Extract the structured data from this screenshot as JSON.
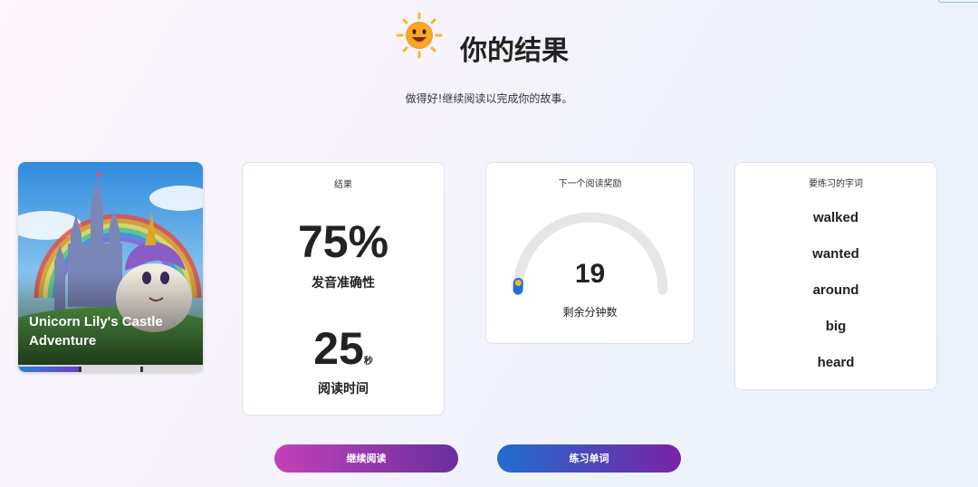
{
  "header": {
    "title": "你的结果",
    "icon": "sun-mascot-icon"
  },
  "subtitle": "做得好!继续阅读以完成你的故事。",
  "book": {
    "title": "Unicorn Lily's Castle Adventure",
    "progress": 0.33,
    "colors": {
      "progress_start": "#2f7fdc",
      "progress_end": "#6d3fbf"
    }
  },
  "results": {
    "label": "结果",
    "accuracy_value": "75%",
    "accuracy_label": "发音准确性",
    "time_value": "25",
    "time_unit": "秒",
    "time_label": "阅读时间"
  },
  "reward": {
    "label": "下一个阅读奖励",
    "minutes": "19",
    "minutes_label": "剩余分钟数",
    "gauge_progress": 0.03
  },
  "practice_words": {
    "label": "要练习的字词",
    "words": [
      "walked",
      "wanted",
      "around",
      "big",
      "heard"
    ]
  },
  "buttons": {
    "continue_label": "继续阅读",
    "practice_label": "练习单词"
  }
}
